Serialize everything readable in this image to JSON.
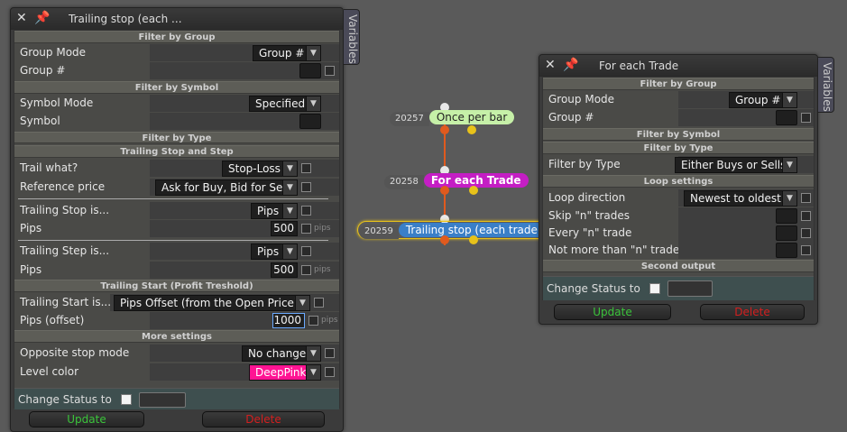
{
  "left_panel": {
    "title": "Trailing stop (each ...",
    "tab": "Variables",
    "sections": {
      "filter_group": "Filter by Group",
      "filter_symbol": "Filter by Symbol",
      "filter_type": "Filter by Type",
      "trailing": "Trailing Stop and Step",
      "trailing_start": "Trailing Start (Profit Treshold)",
      "more": "More settings"
    },
    "group_mode_label": "Group Mode",
    "group_mode_value": "Group #",
    "group_num_label": "Group #",
    "symbol_mode_label": "Symbol Mode",
    "symbol_mode_value": "Specified",
    "symbol_label": "Symbol",
    "trail_what_label": "Trail what?",
    "trail_what_value": "Stop-Loss",
    "ref_price_label": "Reference price",
    "ref_price_value": "Ask for Buy, Bid for Sell",
    "ts_is_label": "Trailing Stop is...",
    "ts_is_value": "Pips",
    "pips_label": "Pips",
    "ts_pips": "500",
    "unit_pips": "pips",
    "tstep_label": "Trailing Step is...",
    "tstep_value": "Pips",
    "tstep_pips": "500",
    "tstart_label": "Trailing Start is...",
    "tstart_value": "Pips Offset (from the Open Price)",
    "pips_offset_label": "Pips (offset)",
    "pips_offset_value": "1000",
    "opp_label": "Opposite stop mode",
    "opp_value": "No change",
    "level_color_label": "Level color",
    "level_color_value": "DeepPink",
    "change_status": "Change Status to",
    "update": "Update",
    "delete": "Delete"
  },
  "right_panel": {
    "title": "For each Trade",
    "tab": "Variables",
    "sections": {
      "filter_group": "Filter by Group",
      "filter_symbol": "Filter by Symbol",
      "filter_type": "Filter by Type",
      "loop": "Loop settings",
      "second": "Second output"
    },
    "group_mode_label": "Group Mode",
    "group_mode_value": "Group #",
    "group_num_label": "Group #",
    "filter_type_label": "Filter by Type",
    "filter_type_value": "Either Buys or Sells",
    "loop_dir_label": "Loop direction",
    "loop_dir_value": "Newest to oldest",
    "skip_label": "Skip \"n\" trades",
    "every_label": "Every \"n\" trade",
    "notmore_label": "Not more than \"n\" trades",
    "change_status": "Change Status to",
    "update": "Update",
    "delete": "Delete"
  },
  "graph": {
    "nodes": [
      {
        "id": "20257",
        "label": "Once per bar",
        "color": "#c6f0a8"
      },
      {
        "id": "20258",
        "label": "For each Trade",
        "color": "#c41ec4"
      },
      {
        "id": "20259",
        "label": "Trailing stop (each trade)",
        "color": "#3a7fc8"
      }
    ]
  },
  "colors": {
    "deep_pink": "#ff1493",
    "update_green": "#3bc43b",
    "delete_red": "#d41f1f",
    "edge_orange": "#e05a1e",
    "dot_yellow": "#e8c21a"
  }
}
